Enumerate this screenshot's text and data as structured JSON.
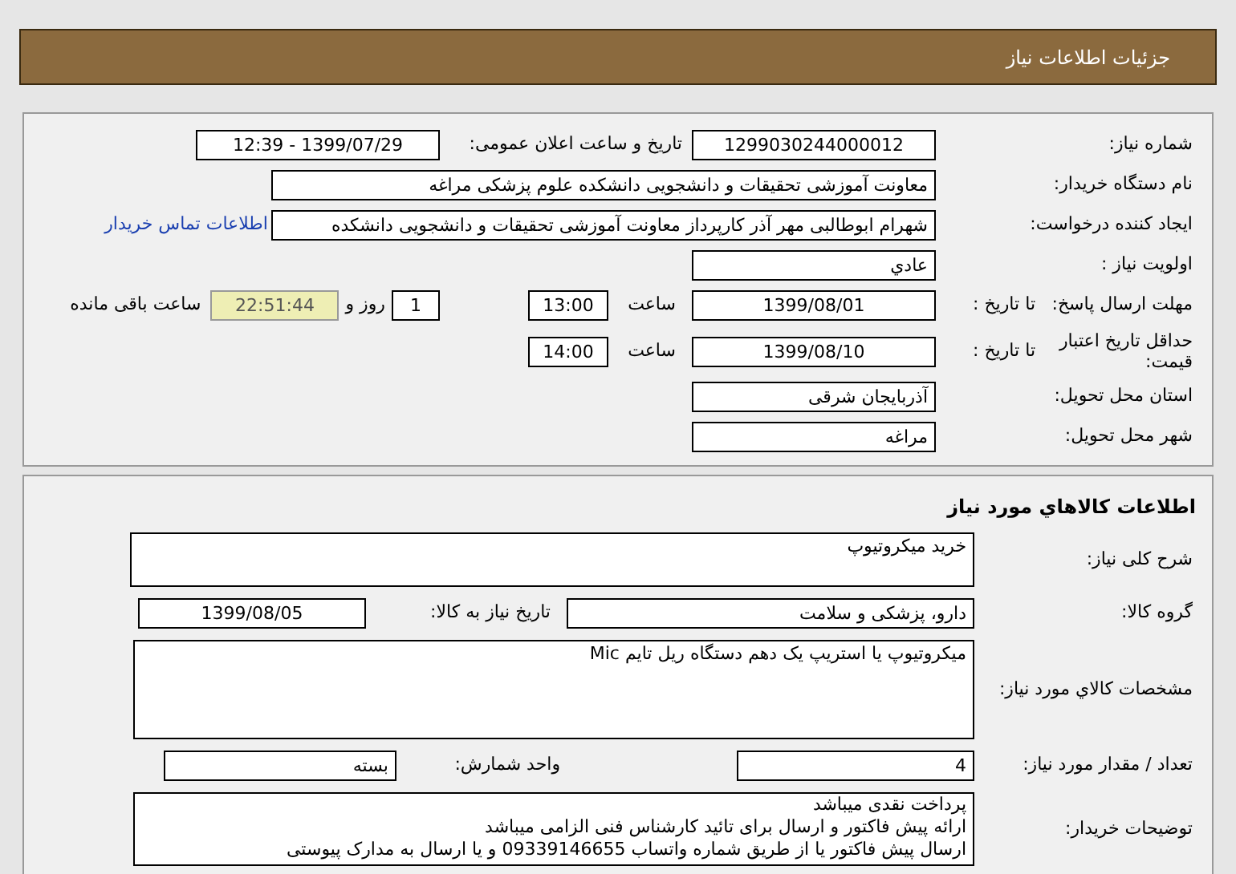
{
  "header": {
    "title": "جزئیات اطلاعات نیاز"
  },
  "details": {
    "need_number": {
      "label": "شماره نیاز:",
      "value": "1299030244000012"
    },
    "announce": {
      "label": "تاریخ و ساعت اعلان عمومی:",
      "value": "1399/07/29 - 12:39"
    },
    "buyer": {
      "label": "نام دستگاه خریدار:",
      "value": "معاونت آموزشی تحقیقات و دانشجویی دانشکده علوم پزشکی مراغه"
    },
    "requester": {
      "label": "ایجاد کننده درخواست:",
      "value": "شهرام ابوطالبی مهر آذر کارپرداز معاونت آموزشی تحقیقات و دانشجویی دانشکده",
      "link": "اطلاعات تماس خریدار"
    },
    "priority": {
      "label": "اولویت نیاز :",
      "value": "عادي"
    },
    "deadline": {
      "label": "مهلت ارسال پاسخ:",
      "date_label": "تا تاریخ :",
      "date": "1399/08/01",
      "time_label": "ساعت",
      "time": "13:00",
      "days": "1",
      "days_label": "روز و",
      "remaining": "22:51:44",
      "remaining_label": "ساعت باقی مانده"
    },
    "validity": {
      "label": "حداقل تاریخ اعتبار قیمت:",
      "date_label": "تا تاریخ :",
      "date": "1399/08/10",
      "time_label": "ساعت",
      "time": "14:00"
    },
    "province": {
      "label": "استان محل تحویل:",
      "value": "آذربایجان شرقی"
    },
    "city": {
      "label": "شهر محل تحویل:",
      "value": "مراغه"
    }
  },
  "goods": {
    "title": "اطلاعات کالاهاي مورد نياز",
    "summary": {
      "label": "شرح کلی نیاز:",
      "value": "خرید میکروتیوپ"
    },
    "group": {
      "label": "گروه کالا:",
      "value": "دارو، پزشکی و سلامت",
      "date_label": "تاریخ نیاز به کالا:",
      "date": "1399/08/05"
    },
    "specs": {
      "label": "مشخصات کالاي مورد نياز:",
      "value": "میکروتیوپ یا استریپ یک دهم دستگاه ریل تایم Mic"
    },
    "quantity": {
      "label": "تعداد / مقدار مورد نیاز:",
      "value": "4",
      "unit_label": "واحد شمارش:",
      "unit": "بسته"
    },
    "notes": {
      "label": "توضیحات خریدار:",
      "lines": [
        "پرداخت نقدی میباشد",
        "ارائه پیش فاکتور و ارسال برای تائید کارشناس فنی الزامی میباشد",
        "ارسال پیش فاکتور یا از طریق شماره واتساب 09339146655 و یا ارسال به مدارک پیوستی"
      ]
    }
  }
}
